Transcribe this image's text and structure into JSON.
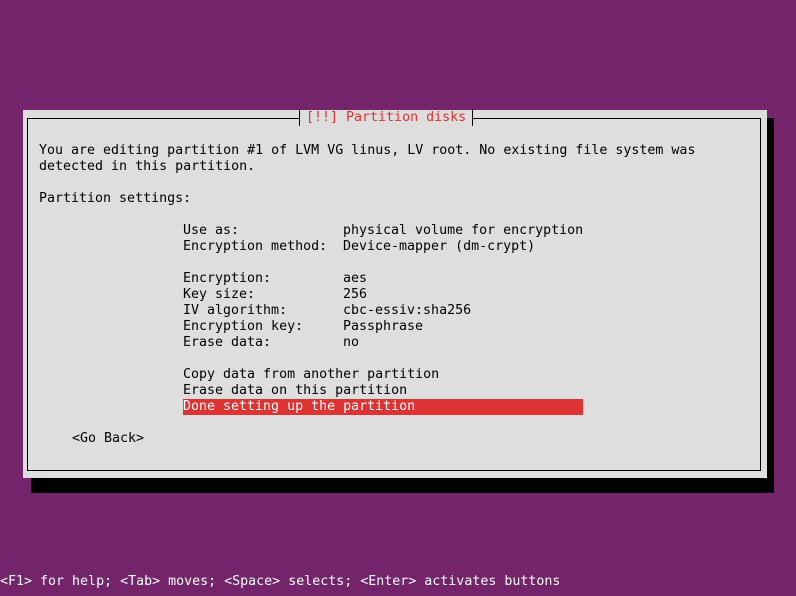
{
  "dialog": {
    "title": "[!!] Partition disks",
    "intro_line1": "You are editing partition #1 of LVM VG linus, LV root. No existing file system was",
    "intro_line2": "detected in this partition.",
    "settings_heading": "Partition settings:",
    "settings_group1": [
      {
        "label": "Use as:",
        "value": "physical volume for encryption"
      },
      {
        "label": "Encryption method:",
        "value": "Device-mapper (dm-crypt)"
      }
    ],
    "settings_group2": [
      {
        "label": "Encryption:",
        "value": "aes"
      },
      {
        "label": "Key size:",
        "value": "256"
      },
      {
        "label": "IV algorithm:",
        "value": "cbc-essiv:sha256"
      },
      {
        "label": "Encryption key:",
        "value": "Passphrase"
      },
      {
        "label": "Erase data:",
        "value": "no"
      }
    ],
    "actions": [
      {
        "label": "Copy data from another partition",
        "selected": false
      },
      {
        "label": "Erase data on this partition",
        "selected": false
      },
      {
        "label": "Done setting up the partition",
        "selected": true
      }
    ],
    "go_back_label": "<Go Back>"
  },
  "status_bar": "<F1> for help; <Tab> moves; <Space> selects; <Enter> activates buttons",
  "colors": {
    "background": "#73246b",
    "dialog": "#dedede",
    "accent": "#dd3333"
  }
}
